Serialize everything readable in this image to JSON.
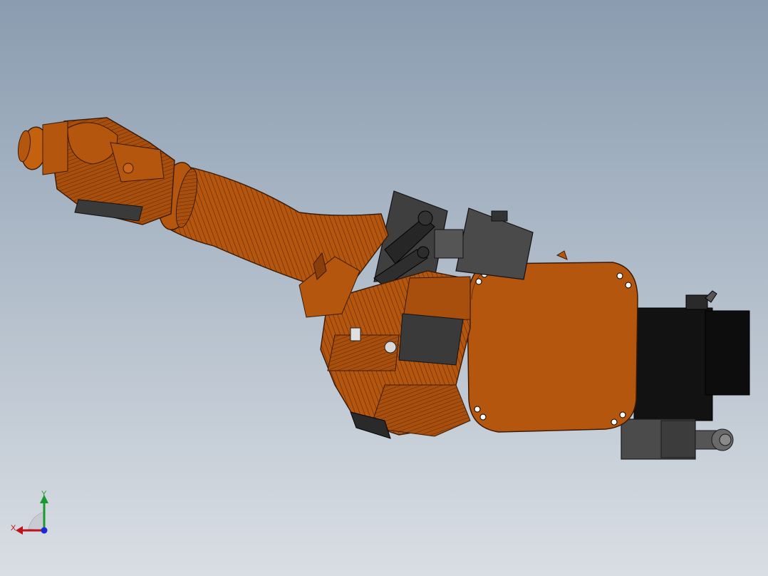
{
  "viewport": {
    "background_top": "#8a9cb0",
    "background_bottom": "#d9dee4"
  },
  "model": {
    "name": "robot-arm-assembly",
    "body_color": "#b5560f",
    "body_dark": "#6e3208",
    "mechanism_color": "#4a4a4a",
    "motor_color": "#121212"
  },
  "triad": {
    "x_label": "X",
    "y_label": "Y",
    "x_color": "#c0101a",
    "y_color": "#1a9a2a",
    "z_color": "#1a2ad0"
  }
}
